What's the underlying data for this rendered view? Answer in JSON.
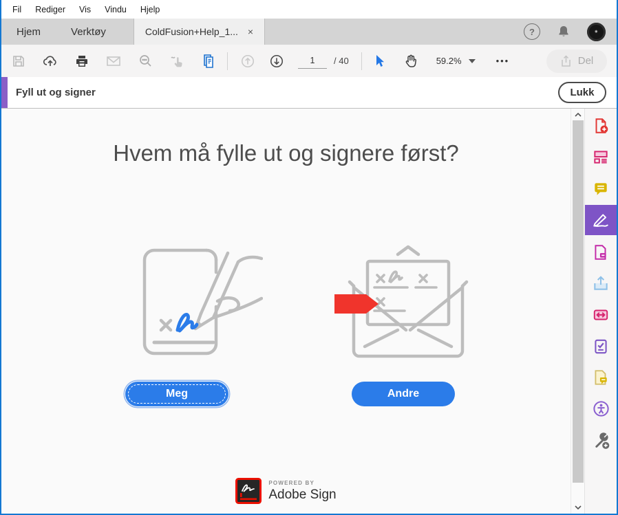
{
  "menubar": {
    "items": [
      "Fil",
      "Rediger",
      "Vis",
      "Vindu",
      "Hjelp"
    ]
  },
  "tabbar": {
    "home_label": "Hjem",
    "tools_label": "Verktøy",
    "doc_label": "ColdFusion+Help_1...",
    "close_glyph": "×",
    "help_glyph": "?"
  },
  "toolbar": {
    "page_value": "1",
    "page_total": "/ 40",
    "zoom_value": "59.2%",
    "more_glyph": "•••",
    "share_label": "Del"
  },
  "fill_sign": {
    "title": "Fyll ut og signer",
    "close_label": "Lukk"
  },
  "content": {
    "heading": "Hvem må fylle ut og signere først?",
    "me_button": "Meg",
    "others_button": "Andre"
  },
  "footer": {
    "powered_by": "POWERED BY",
    "brand": "Adobe Sign"
  },
  "sidebar": {
    "tools": [
      "create-pdf",
      "combine-files",
      "comment",
      "fill-and-sign",
      "edit-pdf",
      "export-pdf",
      "compress-pdf",
      "prepare-form",
      "request-comments",
      "accessibility",
      "add-tools"
    ],
    "active_tool": "fill-and-sign"
  },
  "colors": {
    "accent_blue": "#2B7CE9",
    "active_purple": "#7E54C6",
    "accent_strip_purple": "#8A5FC7",
    "flag_red": "#F0342C",
    "adobe_logo_red": "#EB1000",
    "window_border_blue": "#1478D2"
  }
}
